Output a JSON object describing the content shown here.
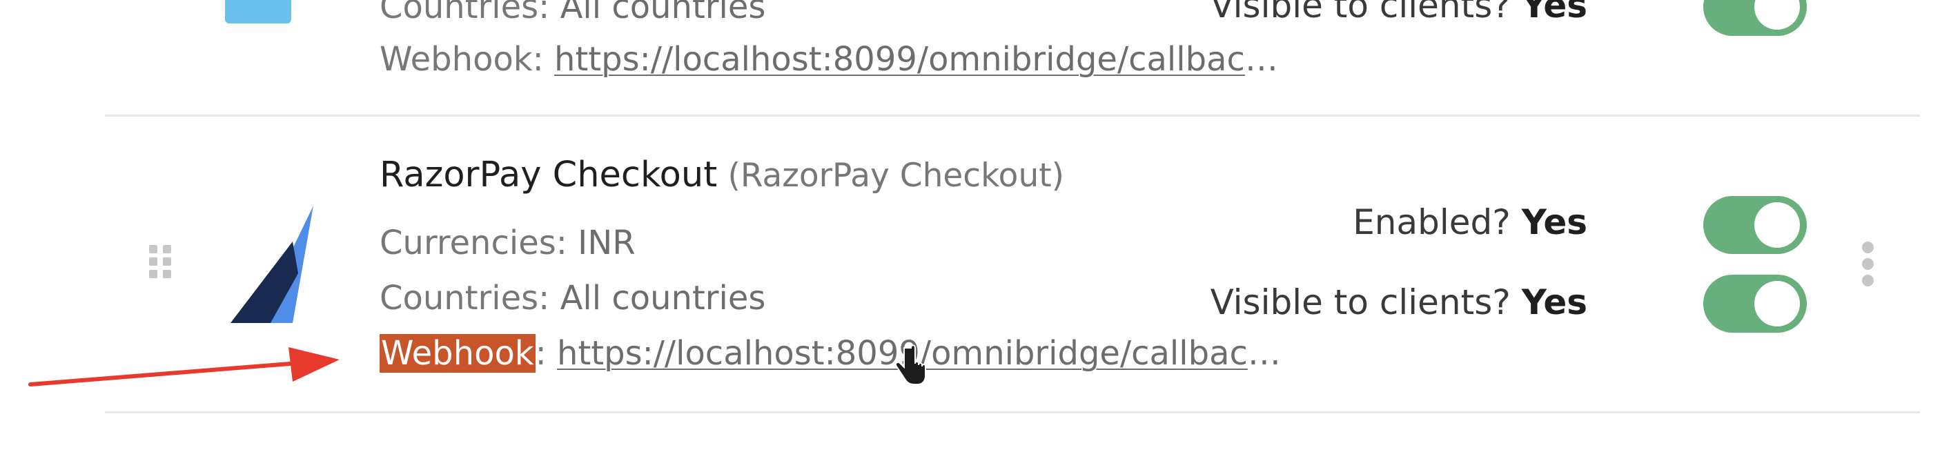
{
  "prev_item": {
    "countries_label": "Countries:",
    "countries_value": "All countries",
    "webhook_label": "Webhook:",
    "webhook_url": "https://localhost:8099/omnibridge/callbac",
    "ellipsis": "…",
    "visible_label": "Visible to clients?",
    "visible_value": "Yes"
  },
  "item": {
    "name": "RazorPay Checkout",
    "subtitle": "(RazorPay Checkout)",
    "currencies_label": "Currencies:",
    "currencies_value": "INR",
    "countries_label": "Countries:",
    "countries_value": "All countries",
    "webhook_label": "Webhook",
    "webhook_colon": ":",
    "webhook_url": "https://localhost:8099/omnibridge/callbac",
    "ellipsis": "…",
    "enabled_label": "Enabled?",
    "enabled_value": "Yes",
    "visible_label": "Visible to clients?",
    "visible_value": "Yes"
  },
  "colors": {
    "toggle_on": "#67b07b",
    "highlight": "#c8542a",
    "arrow": "#e8392d",
    "logo_dark": "#182a50",
    "logo_light": "#4f8de9"
  },
  "icons": [
    "drag-handle-icon",
    "razorpay-logo-icon",
    "kebab-menu-icon",
    "cursor-icon",
    "annotation-arrow-icon"
  ]
}
